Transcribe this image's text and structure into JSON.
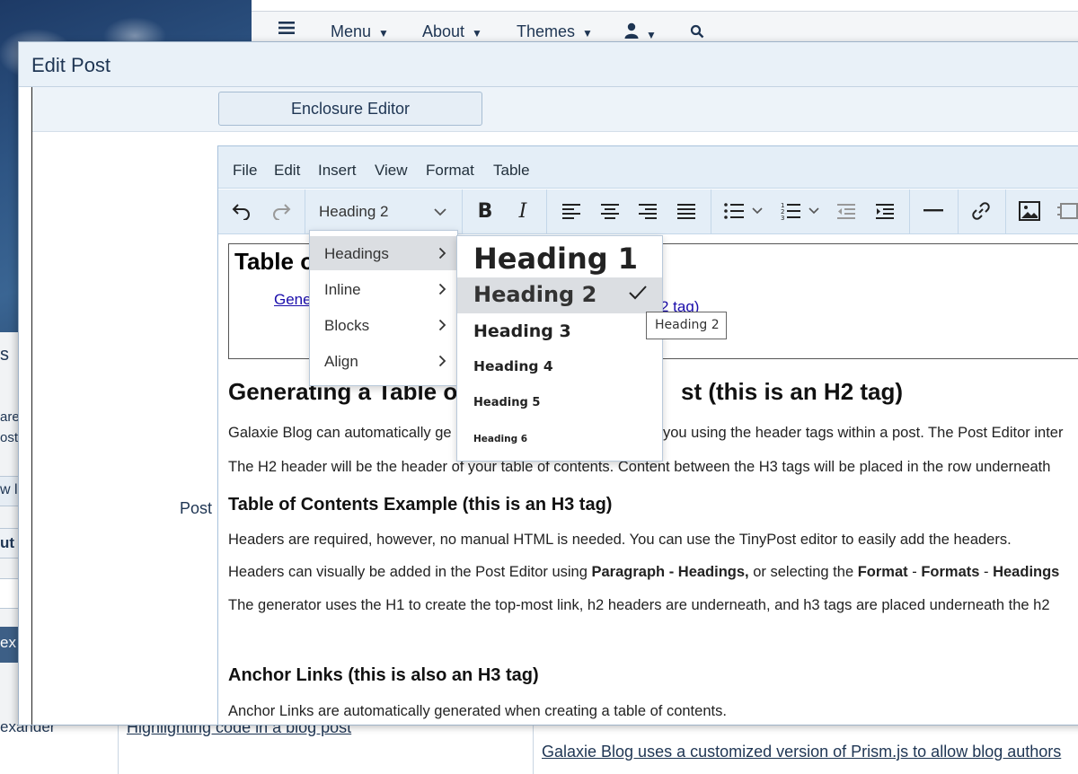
{
  "topnav": {
    "menu_label": "Menu",
    "about_label": "About",
    "themes_label": "Themes",
    "icons": [
      "hamburger-icon",
      "user-icon",
      "search-icon"
    ]
  },
  "background": {
    "fragments": [
      "s",
      "are",
      "ost",
      "w l",
      "ut",
      "ex"
    ],
    "author_fragment": "exander",
    "link_left": "Highlighting code in a blog post",
    "link_right": "Galaxie Blog uses a customized version of Prism.js to allow blog authors"
  },
  "modal": {
    "title": "Edit Post",
    "enclosure_button": "Enclosure Editor",
    "post_label": "Post"
  },
  "editor": {
    "menubar": [
      "File",
      "Edit",
      "Insert",
      "View",
      "Format",
      "Table"
    ],
    "block_format": "Heading 2",
    "toolbar_icons": [
      "undo-icon",
      "redo-icon",
      "bold-icon",
      "italic-icon",
      "align-left-icon",
      "align-center-icon",
      "align-right-icon",
      "justify-icon",
      "bullet-list-icon",
      "numbered-list-icon",
      "outdent-icon",
      "indent-icon",
      "horizontal-rule-icon",
      "link-icon",
      "image-icon",
      "media-icon"
    ]
  },
  "content": {
    "toc_title": "Table o",
    "toc_link_fragment": "Gene",
    "toc_link_end": "2 tag)",
    "h2": "Generating a Table of C",
    "h2_end": "st (this is an H2 tag)",
    "p1_start": "Galaxie Blog can automatically ge",
    "p1_end": "you using the header tags within a post. The Post Editor inter",
    "p2": "The H2 header will be the header of your table of contents. Content between the H3 tags will be placed in the row underneath",
    "h3_1": "Table of Contents Example (this is an H3 tag)",
    "p3": "Headers are required, however, no manual HTML is needed. You can use the TinyPost editor to easily add the headers.",
    "p4_a": "Headers can visually be added in the Post Editor using ",
    "p4_b": "Paragraph - Headings,",
    "p4_c": " or selecting the ",
    "p4_d": "Format",
    "p4_e": " - ",
    "p4_f": "Formats",
    "p4_g": " -  ",
    "p4_h": "Headings",
    "p5": "The generator uses the H1 to create the top-most link, h2 headers are underneath, and h3 tags are placed underneath the h2",
    "h3_2": "Anchor Links (this is also an H3 tag)",
    "p6": "Anchor Links are automatically generated when creating a table of contents."
  },
  "formats_menu": {
    "items": [
      "Headings",
      "Inline",
      "Blocks",
      "Align"
    ],
    "active": "Headings"
  },
  "headings_menu": {
    "items": [
      "Heading 1",
      "Heading 2",
      "Heading 3",
      "Heading 4",
      "Heading 5",
      "Heading 6"
    ],
    "selected": "Heading 2",
    "tooltip": "Heading 2"
  },
  "colors": {
    "accent": "#1e3553",
    "panel": "#e4eef7",
    "link": "#1a0dab",
    "active_item": "#dbdee2"
  }
}
